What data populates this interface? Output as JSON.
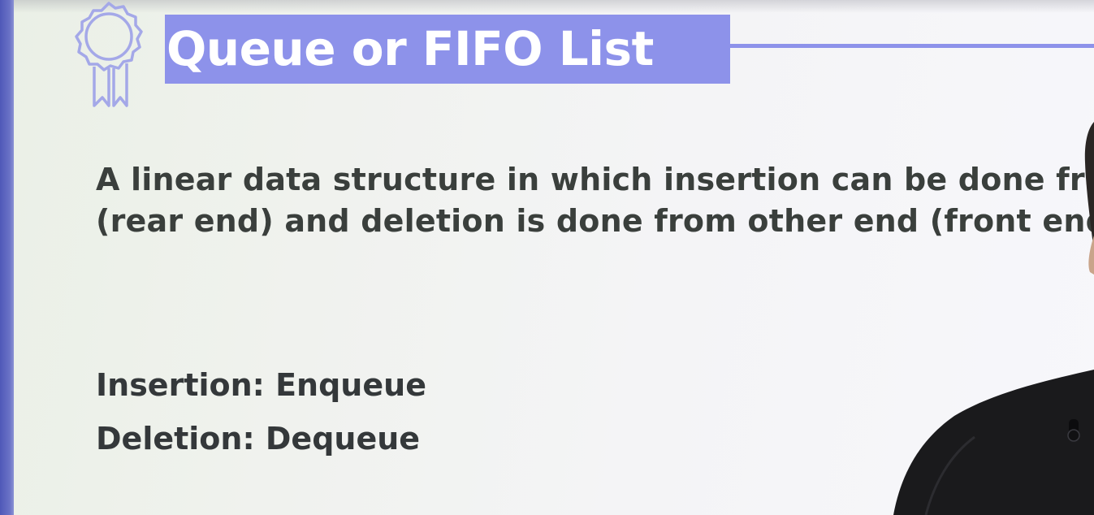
{
  "slide": {
    "title": "Queue or FIFO List",
    "description_line_1": "A linear data structure in which insertion can be done fro",
    "description_line_2": "(rear end) and deletion is done from other end (front end",
    "insertion": "Insertion: Enqueue",
    "deletion": "Deletion: Dequeue",
    "icon": "award-ribbon-icon"
  },
  "colors": {
    "accent": "#8d92ea",
    "left_edge": "#5a62c0",
    "text": "#3a3f3c",
    "presenter_shirt": "#1a1a1c"
  }
}
